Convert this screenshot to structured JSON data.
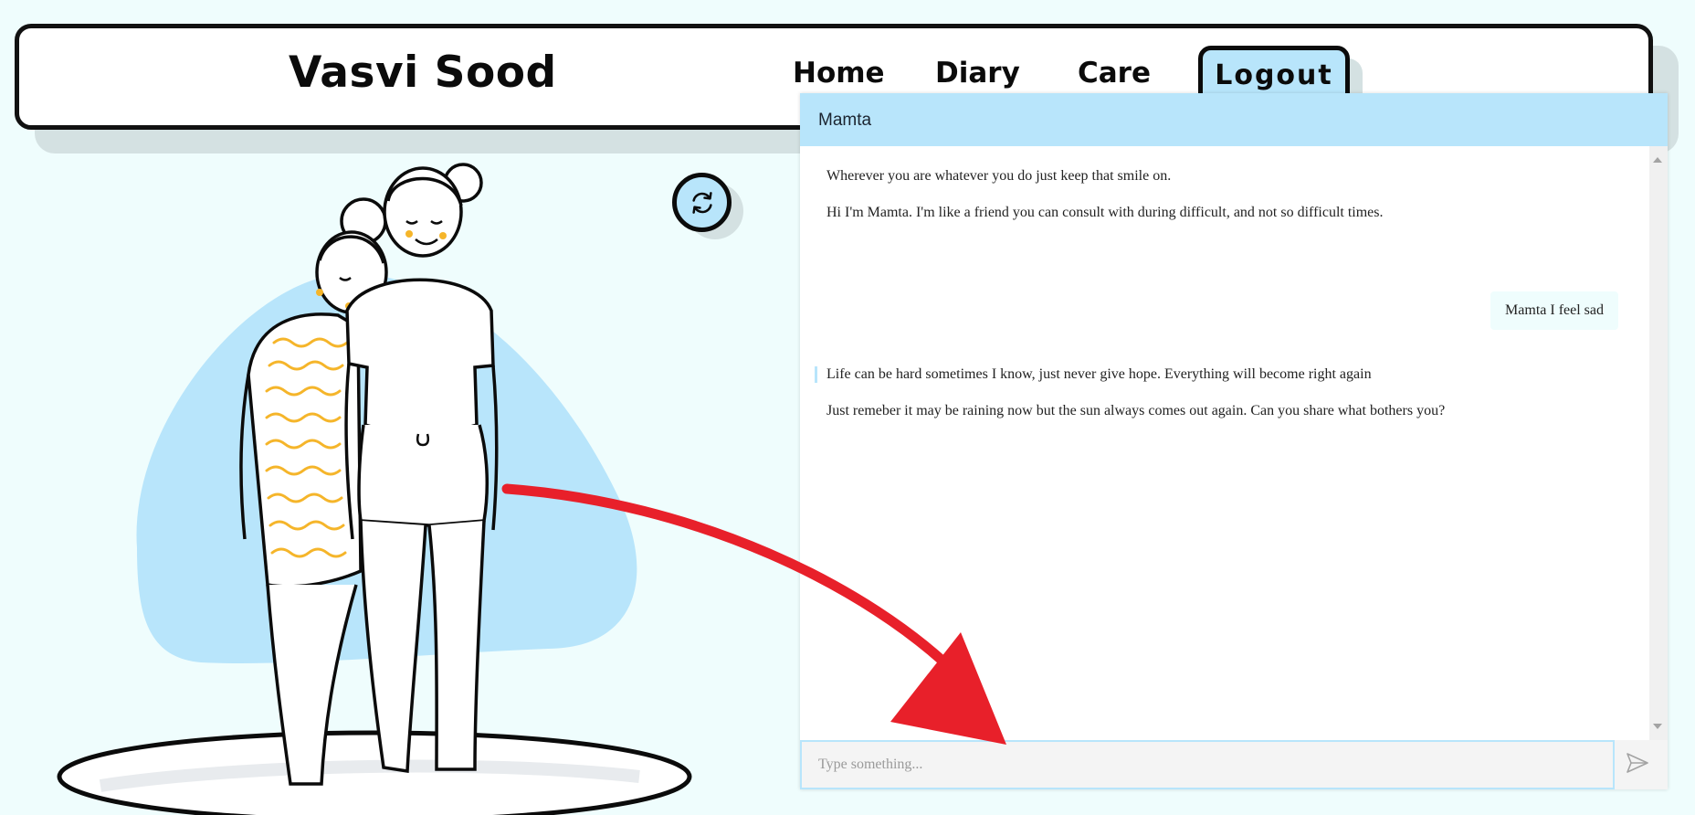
{
  "header": {
    "brand": "Vasvi Sood",
    "nav": {
      "home": "Home",
      "diary": "Diary",
      "care": "Care",
      "logout": "Logout"
    }
  },
  "refresh": {
    "icon": "refresh-icon"
  },
  "chat": {
    "title": "Mamta",
    "messages": [
      {
        "from": "bot",
        "text": "Wherever you are whatever you do just keep that smile on."
      },
      {
        "from": "bot",
        "text": "Hi I'm Mamta. I'm like a friend you can consult with during difficult, and not so difficult times."
      },
      {
        "from": "user",
        "text": "Mamta I feel sad"
      },
      {
        "from": "bot",
        "text": "Life can be hard sometimes I know, just never give hope. Everything will become right again"
      },
      {
        "from": "bot",
        "text": "Just remeber it may be raining now but the sun always comes out again. Can you share what bothers you?"
      }
    ],
    "input": {
      "value": "",
      "placeholder": "Type something..."
    },
    "send_icon": "send-icon"
  },
  "colors": {
    "background": "#effdfd",
    "accent": "#b8e5fb",
    "arrow": "#e8202a",
    "stripes": "#f5b52a"
  }
}
